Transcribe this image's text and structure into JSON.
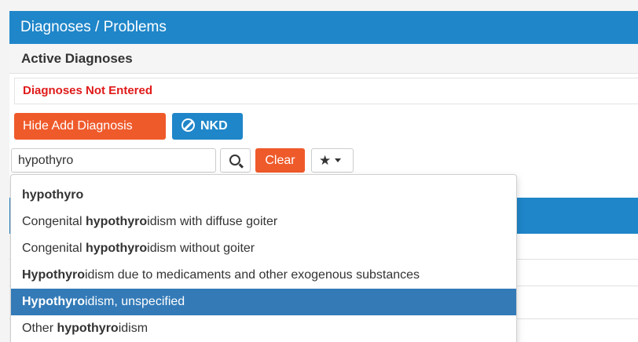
{
  "panel": {
    "title": "Diagnoses / Problems",
    "section_title": "Active Diagnoses",
    "empty_message": "Diagnoses Not Entered"
  },
  "toolbar": {
    "hide_add_label": "Hide Add Diagnosis",
    "nkd_label": "NKD",
    "clear_label": "Clear"
  },
  "search": {
    "value": "hypothyro",
    "button_icon": "search-icon",
    "favorites_icon": "star-icon"
  },
  "dropdown": {
    "items": [
      {
        "pre": "",
        "match": "hypothyro",
        "post": "",
        "selected": false
      },
      {
        "pre": "Congenital ",
        "match": "hypothyro",
        "post": "idism with diffuse goiter",
        "selected": false
      },
      {
        "pre": "Congenital ",
        "match": "hypothyro",
        "post": "idism without goiter",
        "selected": false
      },
      {
        "pre": "",
        "match": "Hypothyro",
        "post": "idism due to medicaments and other exogenous substances",
        "selected": false
      },
      {
        "pre": "",
        "match": "Hypothyro",
        "post": "idism, unspecified",
        "selected": true
      },
      {
        "pre": "Other ",
        "match": "hypothyro",
        "post": "idism",
        "selected": false
      }
    ]
  },
  "colors": {
    "header_blue": "#1f86c9",
    "action_orange": "#ef5a2b",
    "selected_blue": "#337ab7",
    "error_red": "#e01a1a"
  }
}
